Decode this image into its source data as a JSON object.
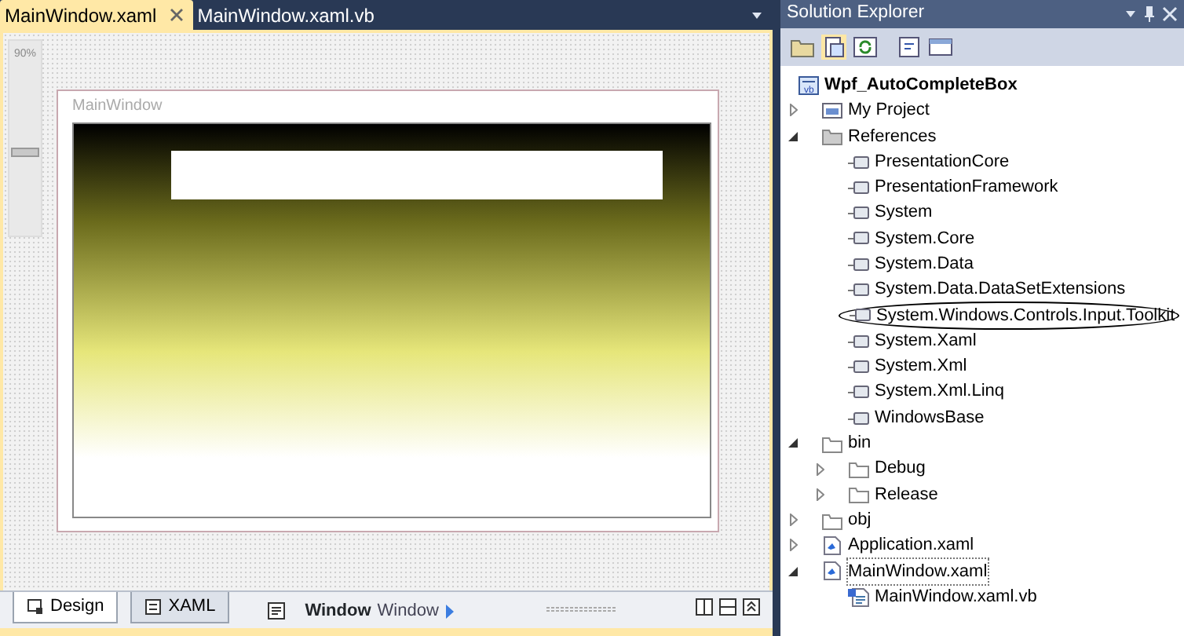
{
  "tabs": [
    {
      "label": "MainWindow.xaml",
      "selected": true,
      "closable": true
    },
    {
      "label": "MainWindow.xaml.vb",
      "selected": false,
      "closable": false
    }
  ],
  "zoom": {
    "label": "90%",
    "level": 0.4
  },
  "designer": {
    "window_title": "MainWindow"
  },
  "view_tabs": [
    {
      "label": "Design",
      "selected": true
    },
    {
      "label": "XAML",
      "selected": false
    }
  ],
  "breadcrumb": {
    "element": "Window",
    "name": "Window"
  },
  "solution_explorer": {
    "title": "Solution Explorer",
    "tree": [
      {
        "label": "Wpf_AutoCompleteBox",
        "kind": "project",
        "selected": false,
        "children": [
          {
            "label": "My Project",
            "kind": "properties",
            "expanded": false,
            "selected": false
          },
          {
            "label": "References",
            "kind": "references",
            "expanded": true,
            "selected": false,
            "children": [
              {
                "label": "PresentationCore",
                "kind": "reference",
                "selected": false,
                "circled": false
              },
              {
                "label": "PresentationFramework",
                "kind": "reference",
                "selected": false,
                "circled": false
              },
              {
                "label": "System",
                "kind": "reference",
                "selected": false,
                "circled": false
              },
              {
                "label": "System.Core",
                "kind": "reference",
                "selected": false,
                "circled": false
              },
              {
                "label": "System.Data",
                "kind": "reference",
                "selected": false,
                "circled": false
              },
              {
                "label": "System.Data.DataSetExtensions",
                "kind": "reference",
                "selected": false,
                "circled": false
              },
              {
                "label": "System.Windows.Controls.Input.Toolkit",
                "kind": "reference",
                "selected": false,
                "circled": true
              },
              {
                "label": "System.Xaml",
                "kind": "reference",
                "selected": false,
                "circled": false
              },
              {
                "label": "System.Xml",
                "kind": "reference",
                "selected": false,
                "circled": false
              },
              {
                "label": "System.Xml.Linq",
                "kind": "reference",
                "selected": false,
                "circled": false
              },
              {
                "label": "WindowsBase",
                "kind": "reference",
                "selected": false,
                "circled": false
              }
            ]
          },
          {
            "label": "bin",
            "kind": "folder",
            "expanded": true,
            "selected": false,
            "children": [
              {
                "label": "Debug",
                "kind": "folder",
                "expanded": false,
                "selected": false
              },
              {
                "label": "Release",
                "kind": "folder",
                "expanded": false,
                "selected": false
              }
            ]
          },
          {
            "label": "obj",
            "kind": "folder",
            "expanded": false,
            "selected": false
          },
          {
            "label": "Application.xaml",
            "kind": "xaml",
            "expanded": false,
            "selected": false
          },
          {
            "label": "MainWindow.xaml",
            "kind": "xaml",
            "expanded": true,
            "selected": true,
            "children": [
              {
                "label": "MainWindow.xaml.vb",
                "kind": "vb",
                "selected": false
              }
            ]
          }
        ]
      }
    ]
  }
}
